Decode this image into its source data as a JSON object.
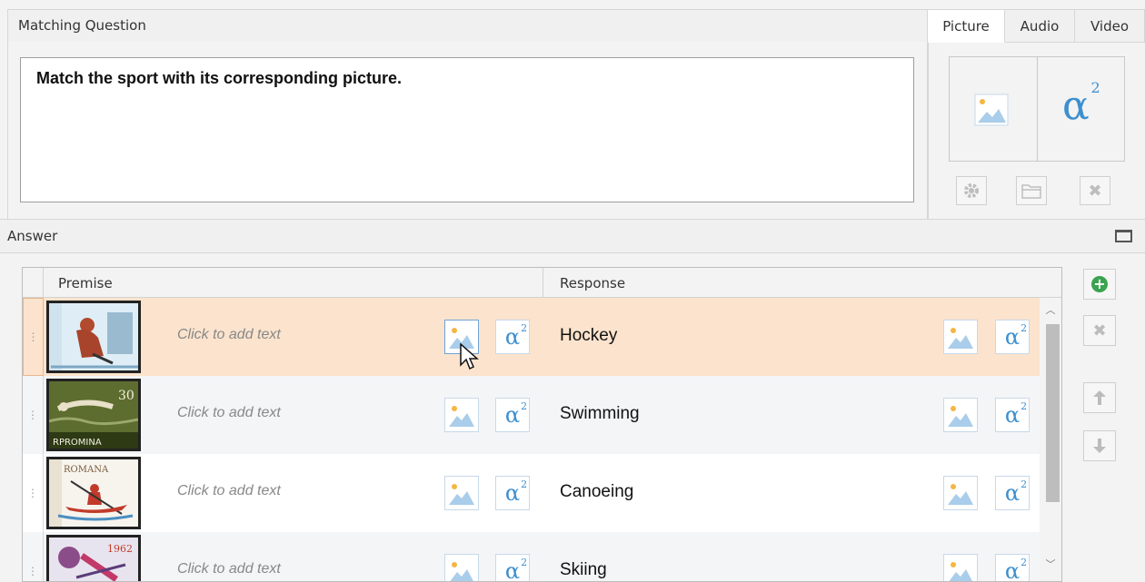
{
  "question": {
    "header": "Matching Question",
    "text": "Match the sport with its corresponding picture."
  },
  "media": {
    "tabs": [
      "Picture",
      "Audio",
      "Video"
    ],
    "active_tab": "Picture",
    "alpha_symbol": "α",
    "alpha_sup": "2"
  },
  "answer": {
    "header": "Answer",
    "columns": {
      "premise": "Premise",
      "response": "Response"
    },
    "placeholder": "Click to add text",
    "rows": [
      {
        "response": "Hockey",
        "stamp": "hockey-stamp",
        "selected": true
      },
      {
        "response": "Swimming",
        "stamp": "swimming-stamp",
        "stamp_text": "RPROMINA",
        "stamp_value": "30"
      },
      {
        "response": "Canoeing",
        "stamp": "canoeing-stamp",
        "stamp_text": "ROMANA"
      },
      {
        "response": "Skiing",
        "stamp": "skiing-stamp",
        "stamp_value": "1962"
      }
    ]
  },
  "colors": {
    "accent_blue": "#3d8fcf",
    "selected_row": "#fbe3cd",
    "add_green": "#3aa34f"
  },
  "icons": [
    "image-icon",
    "formula-icon",
    "gear-icon",
    "folder-icon",
    "close-icon",
    "add-icon",
    "delete-icon",
    "move-up-icon",
    "move-down-icon",
    "maximize-icon",
    "drag-handle-icon"
  ]
}
